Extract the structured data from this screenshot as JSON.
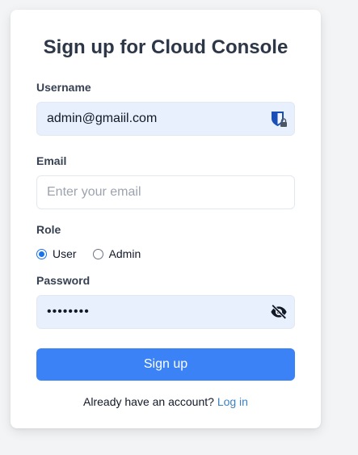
{
  "form": {
    "title": "Sign up for Cloud Console",
    "username": {
      "label": "Username",
      "value": "admin@gmaiil.com",
      "icon": "password-manager-icon"
    },
    "email": {
      "label": "Email",
      "placeholder": "Enter your email",
      "value": ""
    },
    "role": {
      "label": "Role",
      "options": [
        {
          "label": "User",
          "selected": true
        },
        {
          "label": "Admin",
          "selected": false
        }
      ]
    },
    "password": {
      "label": "Password",
      "masked_value": "••••••••",
      "icon": "eye-off-icon"
    },
    "submit_label": "Sign up",
    "footer": {
      "prompt": "Already have an account?",
      "login_link": "Log in"
    }
  },
  "colors": {
    "page_bg": "#f3f4f6",
    "card_bg": "#ffffff",
    "accent": "#3b82f6",
    "autofill_bg": "#e8f0fe",
    "link": "#3b82c4",
    "title": "#2d3748"
  }
}
